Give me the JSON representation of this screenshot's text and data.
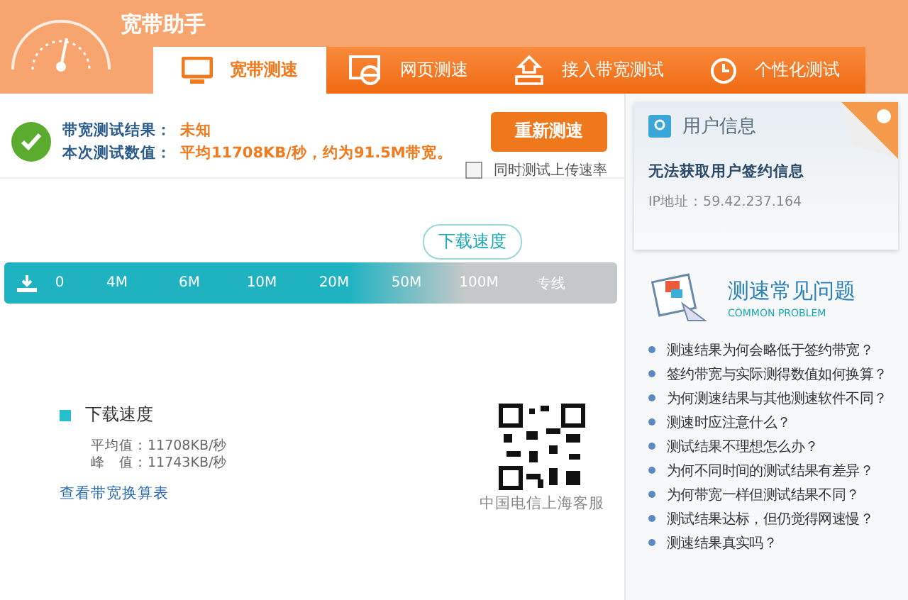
{
  "app": {
    "title": "宽带助手"
  },
  "tabs": [
    {
      "label": "宽带测速",
      "kind": "monitor",
      "selected": true
    },
    {
      "label": "网页测速",
      "kind": "browser",
      "selected": false
    },
    {
      "label": "接入带宽测试",
      "kind": "house",
      "selected": false
    },
    {
      "label": "个性化测试",
      "kind": "clock",
      "selected": false
    }
  ],
  "result": {
    "rows": [
      {
        "label": "带宽测试结果：",
        "value": "未知"
      },
      {
        "label": "本次测试数值：",
        "value": "平均11708KB/秒，约为91.5M带宽。"
      }
    ],
    "retest_button": "重新测速",
    "upload_option": {
      "label": "同时测试上传速率",
      "checked": false
    }
  },
  "speed_scale": {
    "bubble": "下载速度",
    "level": 0.75,
    "ticks": [
      "0",
      "4M",
      "6M",
      "10M",
      "20M",
      "50M",
      "100M",
      "专线"
    ]
  },
  "legend": {
    "title": "下载速度",
    "stats": [
      "平均值：11708KB/秒",
      "峰　值：11743KB/秒"
    ],
    "link": "查看带宽换算表"
  },
  "qr": {
    "caption": "中国电信上海客服"
  },
  "user_info": {
    "title": "用户信息",
    "message": "无法获取用户签约信息",
    "ip": "IP地址：59.42.237.164"
  },
  "faq": {
    "title": "测速常见问题",
    "subtitle": "COMMON PROBLEM",
    "items": [
      "测速结果为何会略低于签约带宽？",
      "签约带宽与实际测得数值如何换算？",
      "为何测速结果与其他测速软件不同？",
      "测速时应注意什么？",
      "测试结果不理想怎么办？",
      "为何不同时间的测试结果有差异？",
      "为何带宽一样但测试结果不同？",
      "测试结果达标，但仍觉得网速慢？",
      "测速结果真实吗？"
    ]
  }
}
